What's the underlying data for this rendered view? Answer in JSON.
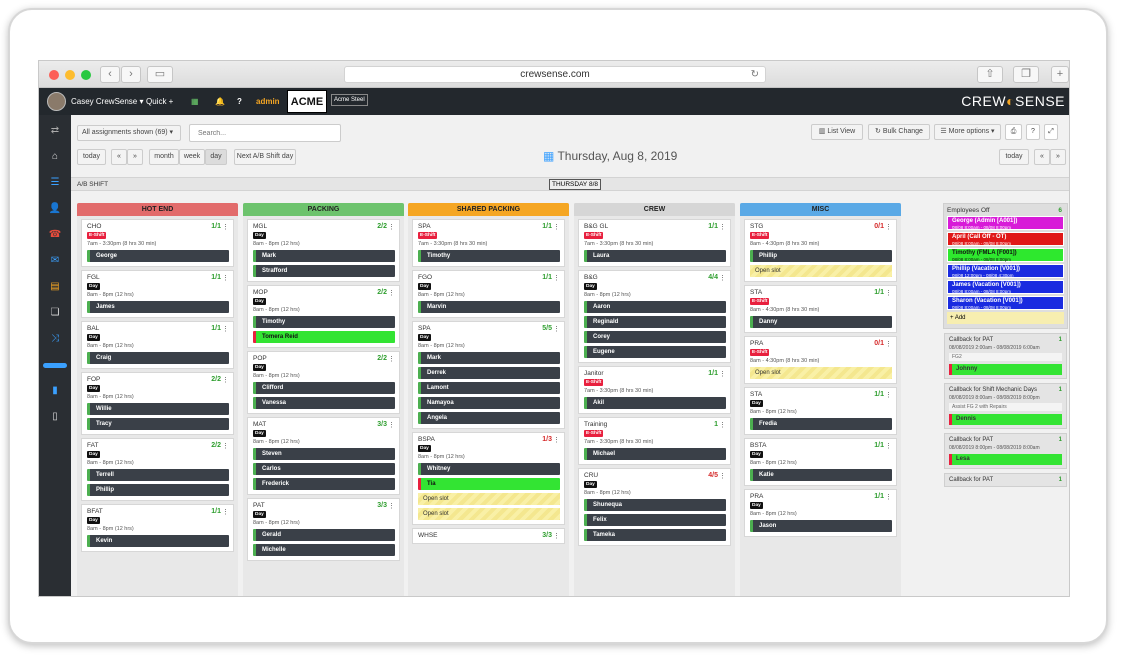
{
  "browser": {
    "url": "crewsense.com"
  },
  "topbar": {
    "user": "Casey CrewSense",
    "quick": "Quick +",
    "admin": "admin",
    "org_logo": "ACME",
    "org_name": "Acme Steel",
    "brand_left": "CREW",
    "brand_right": "SENSE"
  },
  "toolbar": {
    "filter": "All assignments shown (69)",
    "search_placeholder": "Search...",
    "list_view": "List View",
    "bulk_change": "Bulk Change",
    "more_options": "More options",
    "today": "today",
    "month": "month",
    "week": "week",
    "day": "day",
    "next_ab": "Next A/B Shift day",
    "date": "Thursday, Aug 8, 2019",
    "today_right": "today",
    "ab_shift": "A/B SHIFT",
    "day_label": "THURSDAY 8/8"
  },
  "columns": [
    {
      "title": "HOT END",
      "color": "#e26b6b",
      "cards": [
        {
          "name": "CHO",
          "count": "1/1",
          "count_color": "#2e9e2e",
          "tag": "E-Shift",
          "time": "7am - 3:30pm (8 hrs 30 min)",
          "people": [
            "George"
          ]
        },
        {
          "name": "FGL",
          "count": "1/1",
          "count_color": "#2e9e2e",
          "tag": "Day",
          "time": "8am - 8pm (12 hrs)",
          "people": [
            "James"
          ]
        },
        {
          "name": "BAL",
          "count": "1/1",
          "count_color": "#2e9e2e",
          "tag": "Day",
          "time": "8am - 8pm (12 hrs)",
          "people": [
            "Craig"
          ]
        },
        {
          "name": "FOP",
          "count": "2/2",
          "count_color": "#2e9e2e",
          "tag": "Day",
          "time": "8am - 8pm (12 hrs)",
          "people": [
            "Willie",
            "Tracy"
          ]
        },
        {
          "name": "FAT",
          "count": "2/2",
          "count_color": "#2e9e2e",
          "tag": "Day",
          "time": "8am - 8pm (12 hrs)",
          "people": [
            "Terrell",
            "Phillip"
          ]
        },
        {
          "name": "BFAT",
          "count": "1/1",
          "count_color": "#2e9e2e",
          "tag": "Day",
          "time": "8am - 8pm (12 hrs)",
          "people": [
            "Kevin"
          ]
        }
      ]
    },
    {
      "title": "PACKING",
      "color": "#6dc36d",
      "cards": [
        {
          "name": "MGL",
          "count": "2/2",
          "count_color": "#2e9e2e",
          "tag": "Day",
          "time": "8am - 8pm (12 hrs)",
          "people": [
            "Mark",
            "Strafford"
          ]
        },
        {
          "name": "MOP",
          "count": "2/2",
          "count_color": "#2e9e2e",
          "tag": "Day",
          "time": "8am - 8pm (12 hrs)",
          "people": [
            "Timothy",
            "Tomera Reid"
          ]
        },
        {
          "name": "POP",
          "count": "2/2",
          "count_color": "#2e9e2e",
          "tag": "Day",
          "time": "8am - 8pm (12 hrs)",
          "people": [
            "Clifford",
            "Vanessa"
          ]
        },
        {
          "name": "MAT",
          "count": "3/3",
          "count_color": "#2e9e2e",
          "tag": "Day",
          "time": "8am - 8pm (12 hrs)",
          "people": [
            "Steven",
            "Carlos",
            "Frederick"
          ]
        },
        {
          "name": "PAT",
          "count": "3/3",
          "count_color": "#2e9e2e",
          "tag": "Day",
          "time": "8am - 8pm (12 hrs)",
          "people": [
            "Gerald",
            "Michelle"
          ]
        }
      ]
    },
    {
      "title": "SHARED PACKING",
      "color": "#f5a623",
      "cards": [
        {
          "name": "SPA",
          "count": "1/1",
          "count_color": "#2e9e2e",
          "tag": "E-Shift",
          "time": "7am - 3:30pm (8 hrs 30 min)",
          "people": [
            "Timothy"
          ]
        },
        {
          "name": "FGO",
          "count": "1/1",
          "count_color": "#2e9e2e",
          "tag": "Day",
          "time": "8am - 8pm (12 hrs)",
          "people": [
            "Marvin"
          ]
        },
        {
          "name": "SPA",
          "count": "5/5",
          "count_color": "#2e9e2e",
          "tag": "Day",
          "time": "8am - 8pm (12 hrs)",
          "people": [
            "Mark",
            "Derrek",
            "Lamont",
            "Namayoa",
            "Angela"
          ]
        },
        {
          "name": "BSPA",
          "count": "1/3",
          "count_color": "#d62b2b",
          "tag": "Day",
          "time": "8am - 8pm (12 hrs)",
          "people": [
            "Whitney",
            "Tia"
          ],
          "slots": [
            "Open slot",
            "Open slot"
          ]
        },
        {
          "name": "WHSE",
          "count": "3/3",
          "count_color": "#2e9e2e",
          "tag": "",
          "time": "",
          "people": []
        }
      ]
    },
    {
      "title": "CREW",
      "color": "#d6d6d6",
      "cards": [
        {
          "name": "B&G GL",
          "count": "1/1",
          "count_color": "#2e9e2e",
          "tag": "E-Shift",
          "time": "7am - 3:30pm (8 hrs 30 min)",
          "people": [
            "Laura"
          ]
        },
        {
          "name": "B&G",
          "count": "4/4",
          "count_color": "#2e9e2e",
          "tag": "Day",
          "time": "8am - 8pm (12 hrs)",
          "people": [
            "Aaron",
            "Reginald",
            "Corey",
            "Eugene"
          ]
        },
        {
          "name": "Janitor",
          "count": "1/1",
          "count_color": "#2e9e2e",
          "tag": "E-Shift",
          "time": "7am - 3:30pm (8 hrs 30 min)",
          "people": [
            "Akil"
          ]
        },
        {
          "name": "Training",
          "count": "1",
          "count_color": "#2e9e2e",
          "tag": "E-Shift",
          "time": "7am - 3:30pm (8 hrs 30 min)",
          "people": [
            "Michael"
          ]
        },
        {
          "name": "CRU",
          "count": "4/5",
          "count_color": "#d62b2b",
          "tag": "Day",
          "time": "8am - 8pm (12 hrs)",
          "people": [
            "Shunequa",
            "Felix",
            "Tameka"
          ]
        }
      ]
    },
    {
      "title": "MISC",
      "color": "#5aa9e6",
      "cards": [
        {
          "name": "STG",
          "count": "0/1",
          "count_color": "#d62b2b",
          "tag": "E-Shift",
          "time": "8am - 4:30pm (8 hrs 30 min)",
          "people": [
            "Phillip"
          ],
          "slots": [
            "Open slot"
          ]
        },
        {
          "name": "STA",
          "count": "1/1",
          "count_color": "#2e9e2e",
          "tag": "E-Shift",
          "time": "8am - 4:30pm (8 hrs 30 min)",
          "people": [
            "Danny"
          ]
        },
        {
          "name": "PRA",
          "count": "0/1",
          "count_color": "#d62b2b",
          "tag": "E-Shift",
          "time": "8am - 4:30pm (8 hrs 30 min)",
          "people": [],
          "slots": [
            "Open slot"
          ]
        },
        {
          "name": "STA",
          "count": "1/1",
          "count_color": "#2e9e2e",
          "tag": "Day",
          "time": "8am - 8pm (12 hrs)",
          "people": [
            "Fredia"
          ]
        },
        {
          "name": "BSTA",
          "count": "1/1",
          "count_color": "#2e9e2e",
          "tag": "Day",
          "time": "8am - 8pm (12 hrs)",
          "people": [
            "Katie"
          ]
        },
        {
          "name": "PRA",
          "count": "1/1",
          "count_color": "#2e9e2e",
          "tag": "Day",
          "time": "8am - 8pm (12 hrs)",
          "people": [
            "Jason"
          ]
        }
      ]
    }
  ],
  "employees_off": {
    "title": "Employees Off",
    "count": "6",
    "add": "+ Add",
    "items": [
      {
        "name": "George (Admin [A001])",
        "time": "08/08 8:00am - 08/08 8:00pm",
        "color": "#d81bd8"
      },
      {
        "name": "April (Call Off - OT)",
        "time": "08/08 8:00am - 08/08 8:00pm",
        "color": "#e01818"
      },
      {
        "name": "Timothy (FMLA [F001])",
        "time": "08/08 8:00am - 08/08 8:00pm",
        "color": "#2ee82e"
      },
      {
        "name": "Phillip (Vacation [V001])",
        "time": "08/08 12:00pm - 08/08 4:30pm",
        "color": "#1a2be0"
      },
      {
        "name": "James (Vacation [V001])",
        "time": "08/08 8:00am - 08/08 8:00pm",
        "color": "#1a2be0"
      },
      {
        "name": "Sharon (Vacation [V001])",
        "time": "08/08 8:00am - 08/08 8:00pm",
        "color": "#1a2be0"
      }
    ]
  },
  "callbacks": [
    {
      "title": "Callback for PAT",
      "count": "1",
      "time": "08/08/2019 2:00am - 08/08/2019 6:00am",
      "note": "FG2",
      "person": "Johnny"
    },
    {
      "title": "Callback for Shift Mechanic Days",
      "count": "1",
      "time": "08/08/2019 8:00am - 08/08/2019 8:00pm",
      "note": "Assist FG 2 with Repairs",
      "person": "Dennis"
    },
    {
      "title": "Callback for PAT",
      "count": "1",
      "time": "08/08/2019 8:00pm - 08/08/2019 8:00am",
      "note": "",
      "person": "Lesa"
    },
    {
      "title": "Callback for PAT",
      "count": "1",
      "time": "",
      "note": "",
      "person": ""
    }
  ]
}
